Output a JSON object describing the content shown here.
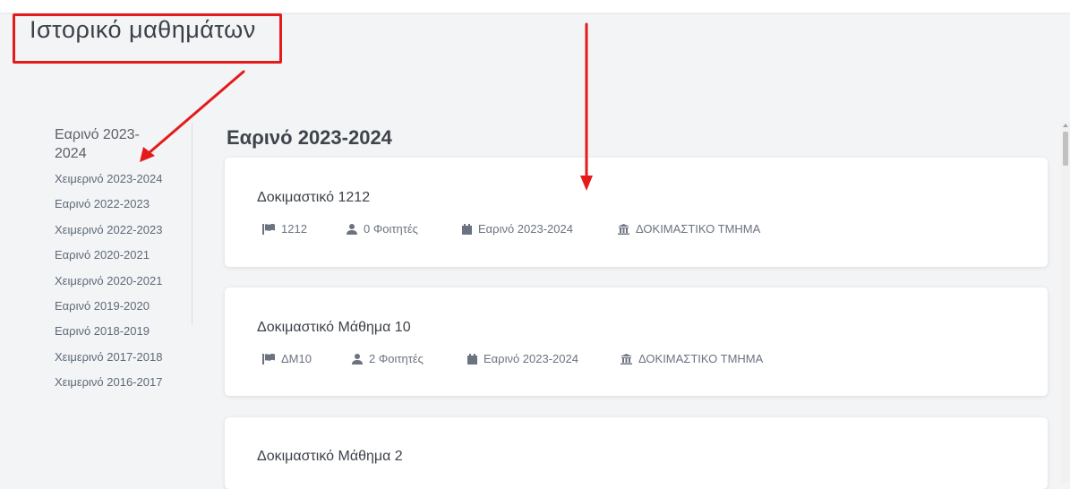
{
  "page": {
    "title": "Ιστορικό μαθημάτων"
  },
  "sidebar": {
    "active": "Εαρινό 2023-2024",
    "items": [
      "Χειμερινό 2023-2024",
      "Εαρινό 2022-2023",
      "Χειμερινό 2022-2023",
      "Εαρινό 2020-2021",
      "Χειμερινό 2020-2021",
      "Εαρινό 2019-2020",
      "Εαρινό 2018-2019",
      "Χειμερινό 2017-2018",
      "Χειμερινό 2016-2017"
    ]
  },
  "main": {
    "heading": "Εαρινό 2023-2024",
    "courses": [
      {
        "title": "Δοκιμαστικό 1212",
        "code": "1212",
        "students": "0 Φοιτητές",
        "semester": "Εαρινό 2023-2024",
        "department": "ΔΟΚΙΜΑΣΤΙΚΟ ΤΜΗΜΑ"
      },
      {
        "title": "Δοκιμαστικό Μάθημα 10",
        "code": "ΔΜ10",
        "students": "2 Φοιτητές",
        "semester": "Εαρινό 2023-2024",
        "department": "ΔΟΚΙΜΑΣΤΙΚΟ ΤΜΗΜΑ"
      },
      {
        "title": "Δοκιμαστικό Μάθημα 2"
      }
    ]
  },
  "icons": {
    "code": "flag-icon",
    "students": "user-icon",
    "semester": "calendar-icon",
    "department": "institution-icon"
  },
  "colors": {
    "annotation": "#e31b1b",
    "card": "#ffffff",
    "background": "#f3f4f6"
  }
}
